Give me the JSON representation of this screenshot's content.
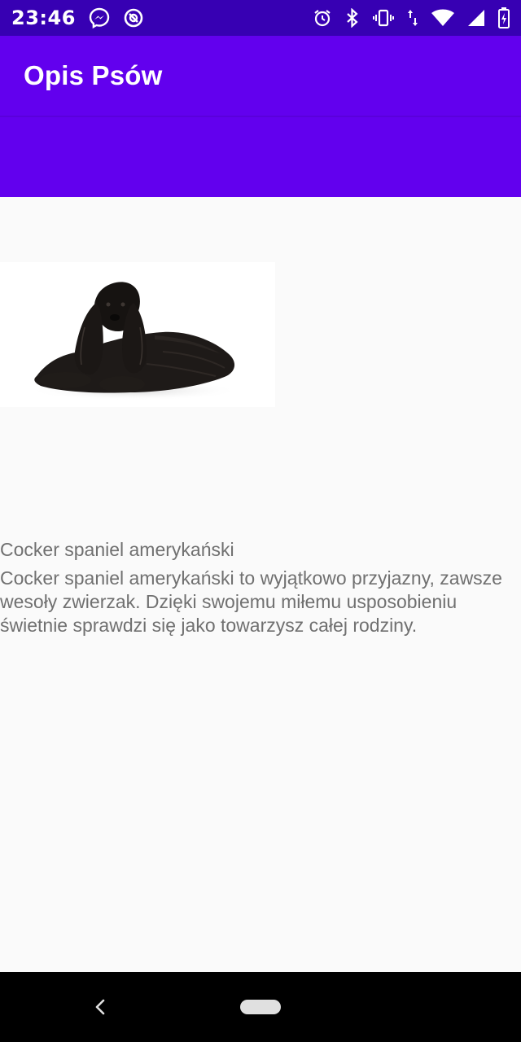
{
  "status_bar": {
    "time": "23:46",
    "left_icons": [
      "messenger-icon",
      "data-saver-icon"
    ],
    "right_icons": [
      "alarm-icon",
      "bluetooth-icon",
      "vibrate-icon",
      "data-arrows-icon",
      "wifi-icon",
      "signal-icon",
      "battery-icon"
    ]
  },
  "app_bar": {
    "title": "Opis Psów"
  },
  "content": {
    "image_subject": "black-cocker-spaniel",
    "dog_name": "Cocker spaniel amerykański",
    "dog_description": "Cocker spaniel amerykański to wyjątkowo przyjazny, zawsze wesoły zwierzak. Dzięki swojemu miłemu usposobieniu świetnie sprawdzi się jako towarzysz całej rodziny."
  },
  "nav_bar": {
    "icons": [
      "back-icon",
      "home-pill-icon"
    ]
  },
  "colors": {
    "status_bar": "#3700b3",
    "app_bar": "#6200ee",
    "background": "#fafafa",
    "text": "#707070",
    "nav_bar": "#000000"
  }
}
